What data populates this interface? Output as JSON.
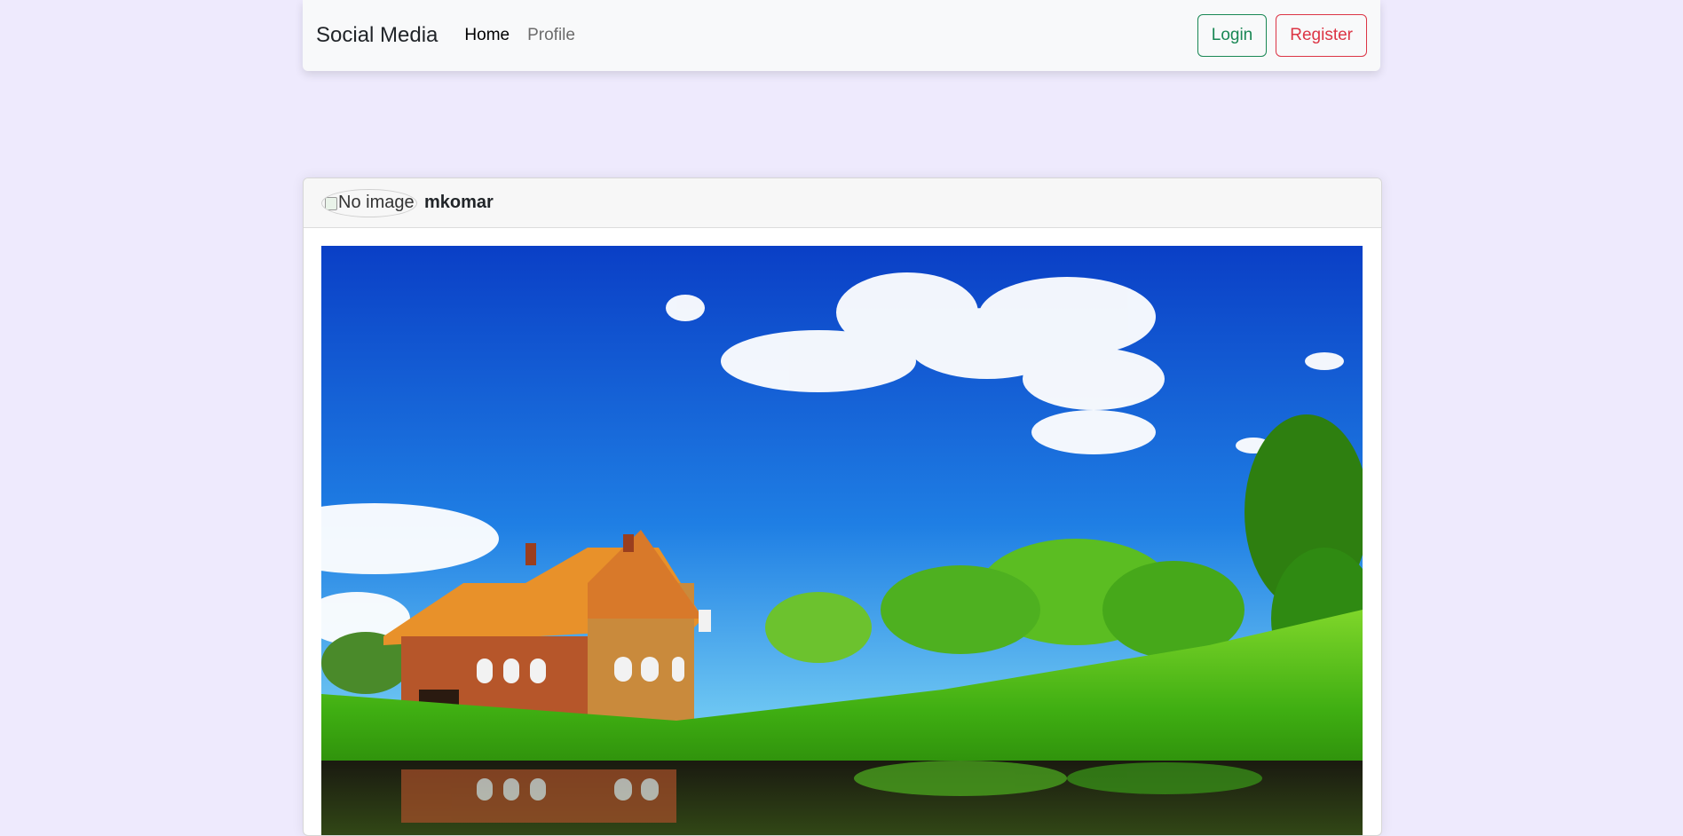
{
  "navbar": {
    "brand": "Social Media",
    "links": [
      {
        "label": "Home",
        "active": true
      },
      {
        "label": "Profile",
        "active": false
      }
    ],
    "login_label": "Login",
    "register_label": "Register"
  },
  "post": {
    "author": "mkomar",
    "avatar_alt": "No image"
  },
  "colors": {
    "background": "#eeeafd",
    "login": "#198754",
    "register": "#dc3545"
  }
}
